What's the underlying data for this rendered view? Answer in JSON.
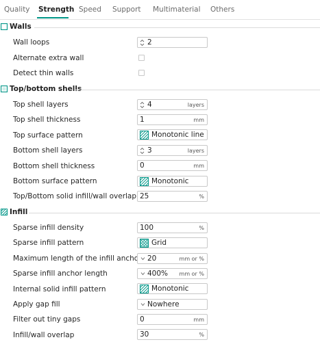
{
  "tabs": [
    {
      "label": "Quality",
      "active": false
    },
    {
      "label": "Strength",
      "active": true
    },
    {
      "label": "Speed",
      "active": false
    },
    {
      "label": "Support",
      "active": false
    },
    {
      "label": "Multimaterial",
      "active": false
    },
    {
      "label": "Others",
      "active": false
    }
  ],
  "colors": {
    "accent": "#009688",
    "border": "#c8c8c8",
    "divider": "#dadada"
  },
  "sections": {
    "walls": {
      "title": "Walls",
      "icon": "walls-icon",
      "wall_loops": {
        "label": "Wall loops",
        "value": "2"
      },
      "alternate_extra_wall": {
        "label": "Alternate extra wall",
        "checked": false
      },
      "detect_thin_walls": {
        "label": "Detect thin walls",
        "checked": false
      }
    },
    "shells": {
      "title": "Top/bottom shells",
      "icon": "shells-icon",
      "top_shell_layers": {
        "label": "Top shell layers",
        "value": "4",
        "unit": "layers"
      },
      "top_shell_thickness": {
        "label": "Top shell thickness",
        "value": "1",
        "unit": "mm"
      },
      "top_surface_pattern": {
        "label": "Top surface pattern",
        "value": "Monotonic line",
        "icon": "monotonic-pattern-icon"
      },
      "bottom_shell_layers": {
        "label": "Bottom shell layers",
        "value": "3",
        "unit": "layers"
      },
      "bottom_shell_thickness": {
        "label": "Bottom shell thickness",
        "value": "0",
        "unit": "mm"
      },
      "bottom_surface_pattern": {
        "label": "Bottom surface pattern",
        "value": "Monotonic",
        "icon": "monotonic-pattern-icon"
      },
      "solid_infill_overlap": {
        "label": "Top/Bottom solid infill/wall overlap",
        "value": "25",
        "unit": "%"
      }
    },
    "infill": {
      "title": "Infill",
      "icon": "infill-icon",
      "sparse_density": {
        "label": "Sparse infill density",
        "value": "100",
        "unit": "%"
      },
      "sparse_pattern": {
        "label": "Sparse infill pattern",
        "value": "Grid",
        "icon": "grid-pattern-icon"
      },
      "max_anchor_length": {
        "label": "Maximum length of the infill anchor",
        "value": "20",
        "unit": "mm or %"
      },
      "anchor_length": {
        "label": "Sparse infill anchor length",
        "value": "400%",
        "unit": "mm or %"
      },
      "internal_solid_pattern": {
        "label": "Internal solid infill pattern",
        "value": "Monotonic",
        "icon": "monotonic-pattern-icon"
      },
      "gap_fill": {
        "label": "Apply gap fill",
        "value": "Nowhere"
      },
      "filter_tiny_gaps": {
        "label": "Filter out tiny gaps",
        "value": "0",
        "unit": "mm"
      },
      "infill_wall_overlap": {
        "label": "Infill/wall overlap",
        "value": "30",
        "unit": "%"
      }
    }
  }
}
